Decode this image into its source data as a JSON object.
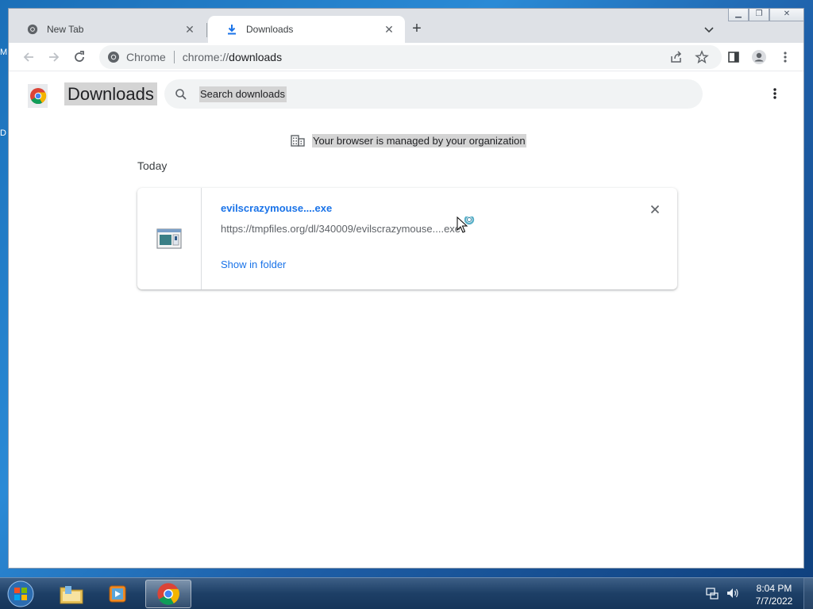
{
  "desktop": {
    "frag_top": "M",
    "frag_mid": "D"
  },
  "browser": {
    "tabs": [
      {
        "title": "New Tab",
        "icon": "chrome-icon",
        "active": false
      },
      {
        "title": "Downloads",
        "icon": "download-icon",
        "active": true
      }
    ],
    "new_tab_label": "+",
    "omnibox": {
      "chip": "Chrome",
      "url_scheme": "chrome://",
      "url_host": "downloads"
    }
  },
  "page": {
    "title": "Downloads",
    "search_placeholder": "Search downloads",
    "managed_notice": "Your browser is managed by your organization",
    "date_header": "Today",
    "downloads": [
      {
        "file_name": "evilscrazymouse....exe",
        "url": "https://tmpfiles.org/dl/340009/evilscrazymouse....exe",
        "action": "Show in folder"
      }
    ]
  },
  "taskbar": {
    "time": "8:04 PM",
    "date": "7/7/2022",
    "apps": [
      "windows-explorer",
      "media-player",
      "chrome"
    ]
  },
  "colors": {
    "accent": "#1a73e8",
    "highlight": "#d4d4d4"
  }
}
